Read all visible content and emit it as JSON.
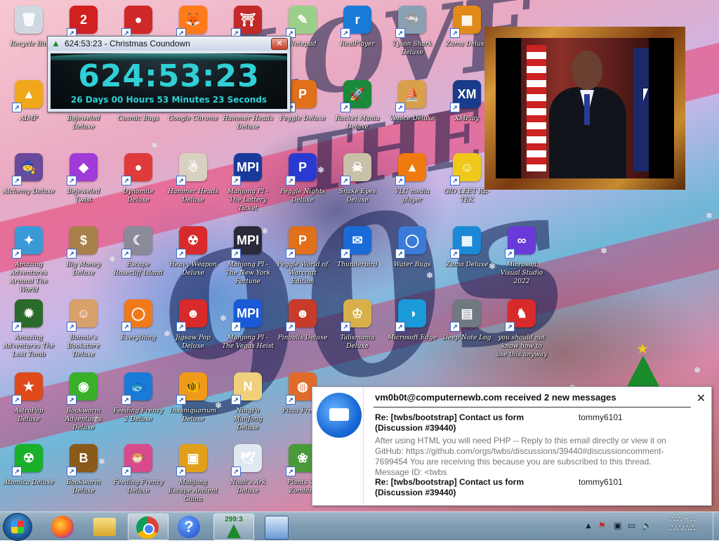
{
  "countdown": {
    "window_title": "624:53:23 - Christmas Coundown",
    "big_time": "624:53:23",
    "detail": "26 Days 00 Hours 53 Minutes 23 Seconds",
    "close_label": "✕"
  },
  "desktop_icons": [
    {
      "label": "Recycle Bin",
      "icon": "recycle-bin-icon",
      "color": "#cfd8e0",
      "glyph": "🗑"
    },
    {
      "label": "",
      "icon": "number-2-icon",
      "color": "#d02020",
      "glyph": "2"
    },
    {
      "label": "",
      "icon": "red-creature-icon",
      "color": "#d02828",
      "glyph": "●"
    },
    {
      "label": "",
      "icon": "firefox-icon",
      "color": "#ff7a1a",
      "glyph": "🦊"
    },
    {
      "label": "",
      "icon": "shrine-icon",
      "color": "#c22a2a",
      "glyph": "⛩"
    },
    {
      "label": "Notepad",
      "icon": "notepad-icon",
      "color": "#9ad08a",
      "glyph": "✎"
    },
    {
      "label": "RealPlayer",
      "icon": "realplayer-icon",
      "color": "#1a7ad8",
      "glyph": "r"
    },
    {
      "label": "Tyson Shark Deluxe",
      "icon": "shark-icon",
      "color": "#8aa0b0",
      "glyph": "🦈"
    },
    {
      "label": "Zuma Deluxe",
      "icon": "zuma-icon",
      "color": "#e08a1a",
      "glyph": "▦"
    },
    {
      "label": "AIMP",
      "icon": "aimp-icon",
      "color": "#f0a81a",
      "glyph": "▲"
    },
    {
      "label": "Bejeweled Deluxe",
      "icon": "bejeweled-icon",
      "color": "#3a6ad8",
      "glyph": "◆"
    },
    {
      "label": "Cosmic Bugs",
      "icon": "cosmic-bugs-icon",
      "color": "#d84a2a",
      "glyph": "✦"
    },
    {
      "label": "Google Chrome",
      "icon": "chrome-icon",
      "color": "#2a9a4a",
      "glyph": "◉"
    },
    {
      "label": "Hammer Heads Deluxe",
      "icon": "hammer-icon",
      "color": "#8a5a3a",
      "glyph": "⚒"
    },
    {
      "label": "Peggle Deluxe",
      "icon": "peggle-icon",
      "color": "#e0701a",
      "glyph": "P"
    },
    {
      "label": "Rocket Mania Deluxe",
      "icon": "rocket-icon",
      "color": "#1a8a3a",
      "glyph": "🚀"
    },
    {
      "label": "Venice Deluxe",
      "icon": "venice-icon",
      "color": "#d8a04a",
      "glyph": "⛵"
    },
    {
      "label": "XMPlay",
      "icon": "xmplay-icon",
      "color": "#1a3a8a",
      "glyph": "XM"
    },
    {
      "label": "Alchemy Deluxe",
      "icon": "alchemy-icon",
      "color": "#6a4a9a",
      "glyph": "🧙"
    },
    {
      "label": "Bejeweled Twist",
      "icon": "bejeweled-twist-icon",
      "color": "#a03ad8",
      "glyph": "◆"
    },
    {
      "label": "Dynomite Deluxe",
      "icon": "dynomite-icon",
      "color": "#e03a3a",
      "glyph": "●"
    },
    {
      "label": "Hammer Heads Deluxe",
      "icon": "gnome-icon",
      "color": "#d8d0c0",
      "glyph": "☃"
    },
    {
      "label": "Mahjong PI - The Lottery Ticket",
      "icon": "mpi-icon",
      "color": "#1a3a9a",
      "glyph": "MPI"
    },
    {
      "label": "Peggle Nights Deluxe",
      "icon": "peggle-nights-icon",
      "color": "#2a3ad0",
      "glyph": "P"
    },
    {
      "label": "Snake Eyes Deluxe",
      "icon": "skull-icon",
      "color": "#c8c0a8",
      "glyph": "☠"
    },
    {
      "label": "VLC media player",
      "icon": "vlc-icon",
      "color": "#f07a10",
      "glyph": "▲"
    },
    {
      "label": "GIO LEET RE-TEK",
      "icon": "smiley-icon",
      "color": "#f0c81a",
      "glyph": "☺"
    },
    {
      "label": "Amazing Adventures Around The World",
      "icon": "amazing-adventures-icon",
      "color": "#3a9ad8",
      "glyph": "✦"
    },
    {
      "label": "Big Money Deluxe",
      "icon": "money-bag-icon",
      "color": "#a8804a",
      "glyph": "$"
    },
    {
      "label": "Escape Rosecliff Island",
      "icon": "moon-icon",
      "color": "#8a8a9a",
      "glyph": "☾"
    },
    {
      "label": "Heavy Weapon Deluxe",
      "icon": "radiation-icon",
      "color": "#d82a2a",
      "glyph": "☢"
    },
    {
      "label": "Mahjong PI - The New York Fortune",
      "icon": "mpi-icon",
      "color": "#2a2a3a",
      "glyph": "MPI"
    },
    {
      "label": "Peggle World of Warcraft Edition",
      "icon": "peggle-wow-icon",
      "color": "#e0701a",
      "glyph": "P"
    },
    {
      "label": "Thunderbird",
      "icon": "thunderbird-icon",
      "color": "#1a6ad8",
      "glyph": "✉"
    },
    {
      "label": "Water Bugs",
      "icon": "ring-icon",
      "color": "#3a7ad8",
      "glyph": "◯"
    },
    {
      "label": "Zuma Deluxe",
      "icon": "blue-tile-icon",
      "color": "#1a8ad8",
      "glyph": "▦"
    },
    {
      "label": "Microsoft Visual Studio 2022",
      "icon": "visual-studio-icon",
      "color": "#6a3ad8",
      "glyph": "∞"
    },
    {
      "label": "Amazing Adventures The Lost Tomb",
      "icon": "compass-icon",
      "color": "#2a6a2a",
      "glyph": "✹"
    },
    {
      "label": "Bonnie's Bookstore Deluxe",
      "icon": "bonnie-icon",
      "color": "#d8a06a",
      "glyph": "☺"
    },
    {
      "label": "Everything",
      "icon": "everything-icon",
      "color": "#f07a1a",
      "glyph": "◯"
    },
    {
      "label": "Jigsaw Pop Deluxe",
      "icon": "jester-icon",
      "color": "#d82a2a",
      "glyph": "☻"
    },
    {
      "label": "Mahjong PI - The Vegas Heist",
      "icon": "mpi-icon",
      "color": "#1a5ad8",
      "glyph": "MPI"
    },
    {
      "label": "Pinballs Deluxe",
      "icon": "pirate-icon",
      "color": "#c83a2a",
      "glyph": "☻"
    },
    {
      "label": "Talismania Deluxe",
      "icon": "king-icon",
      "color": "#d8b04a",
      "glyph": "♔"
    },
    {
      "label": "Microsoft Edge",
      "icon": "edge-icon",
      "color": "#1a9ad8",
      "glyph": "◑"
    },
    {
      "label": "Deep Note Log",
      "icon": "stack-icon",
      "color": "#707880",
      "glyph": "▤"
    },
    {
      "label": "you should not know how to use this anyway",
      "icon": "dragon-icon",
      "color": "#d82a2a",
      "glyph": "♞"
    },
    {
      "label": "AstroPop Deluxe",
      "icon": "astropop-icon",
      "color": "#e04a1a",
      "glyph": "★"
    },
    {
      "label": "Bookworm Adventures Deluxe",
      "icon": "bookworm-icon",
      "color": "#3ab02a",
      "glyph": "◉"
    },
    {
      "label": "Feeding Frenzy 2 Deluxe",
      "icon": "fish-icon",
      "color": "#1a7ad8",
      "glyph": "🐟"
    },
    {
      "label": "Insaniquarium Deluxe",
      "icon": "goldfish-icon",
      "color": "#f09a1a",
      "glyph": "🐠"
    },
    {
      "label": "NingPo MahJong Deluxe",
      "icon": "ningpo-icon",
      "color": "#f0d07a",
      "glyph": "N"
    },
    {
      "label": "Pizza Frenzy",
      "icon": "pizza-icon",
      "color": "#e06a2a",
      "glyph": "◍"
    },
    {
      "label": "Atomica Deluxe",
      "icon": "atomica-icon",
      "color": "#1ab02a",
      "glyph": "☢"
    },
    {
      "label": "Bookworm Deluxe",
      "icon": "bookworm-deluxe-icon",
      "color": "#8a5a1a",
      "glyph": "B"
    },
    {
      "label": "Feeding Frenzy Deluxe",
      "icon": "fish2-icon",
      "color": "#d84a8a",
      "glyph": "🐡"
    },
    {
      "label": "Mahjong Escape Ancient China",
      "icon": "mahjong-icon",
      "color": "#e0a01a",
      "glyph": "▣"
    },
    {
      "label": "Noah's Ark Deluxe",
      "icon": "dove-icon",
      "color": "#e0e8f0",
      "glyph": "🕊"
    },
    {
      "label": "Plants vs. Zombies",
      "icon": "plants-icon",
      "color": "#4a9a3a",
      "glyph": "❀"
    }
  ],
  "notification": {
    "header": "vm0b0t@computernewb.com received 2 new messages",
    "close_label": "✕",
    "messages": [
      {
        "subject": "Re: [twbs/bootstrap] Contact us form (Discussion #39440)",
        "from": "tommy6101",
        "body": "After using HTML you will need PHP -- Reply to this email directly or view it on GitHub: https://github.com/orgs/twbs/discussions/39440#discussioncomment-7699454 You are receiving this because you are subscribed to this thread. Message ID: <twbs"
      },
      {
        "subject": "Re: [twbs/bootstrap] Contact us form (Discussion #39440)",
        "from": "tommy6101",
        "body": ""
      }
    ]
  },
  "taskbar": {
    "buttons": [
      {
        "name": "firefox",
        "icon": "firefox-icon"
      },
      {
        "name": "explorer",
        "icon": "folder-icon"
      },
      {
        "name": "chrome",
        "icon": "chrome-icon"
      },
      {
        "name": "help",
        "icon": "help-icon"
      },
      {
        "name": "christmas-countdown",
        "icon": "tree-icon",
        "label": "299:3"
      },
      {
        "name": "control-panel",
        "icon": "control-panel-icon"
      }
    ],
    "clock_line1": "ஃ:ஃ ஐஃ",
    "clock_line2": "ஃ/ஃ/ஃஃ"
  },
  "colors": {
    "countdown_text": "#2fd0d6",
    "taskbar": "#7f9cb2",
    "accent": "#1a6ad8"
  }
}
